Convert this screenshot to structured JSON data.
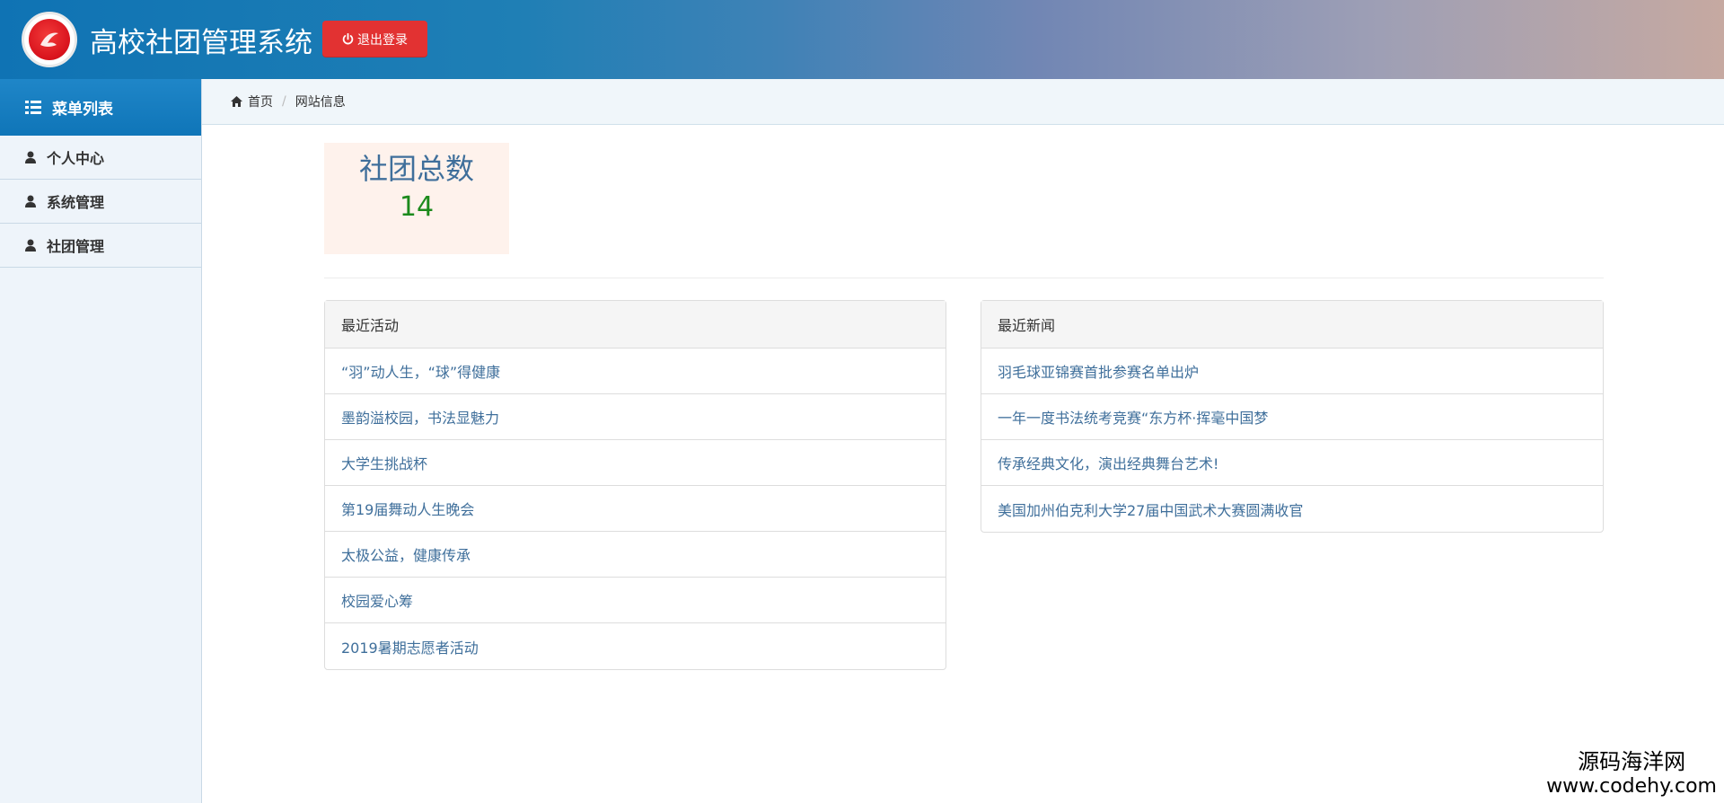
{
  "header": {
    "title": "高校社团管理系统",
    "logout_label": "退出登录",
    "logout_icon": "power-icon",
    "logo_icon": "university-logo"
  },
  "sidebar": {
    "menu_title": "菜单列表",
    "menu_icon": "list-icon",
    "items": [
      {
        "label": "个人中心",
        "icon": "user-icon"
      },
      {
        "label": "系统管理",
        "icon": "user-icon"
      },
      {
        "label": "社团管理",
        "icon": "user-icon"
      }
    ]
  },
  "breadcrumb": {
    "home": "首页",
    "current": "网站信息",
    "home_icon": "home-icon"
  },
  "stat": {
    "label": "社团总数",
    "value": "14"
  },
  "activities": {
    "title": "最近活动",
    "items": [
      "“羽”动人生，“球”得健康",
      "墨韵溢校园，书法显魅力",
      "大学生挑战杯",
      "第19届舞动人生晚会",
      "太极公益，健康传承",
      "校园爱心筹",
      "2019暑期志愿者活动"
    ]
  },
  "news": {
    "title": "最近新闻",
    "items": [
      "羽毛球亚锦赛首批参赛名单出炉",
      "一年一度书法统考竞赛“东方杯·挥毫中国梦",
      "传承经典文化，演出经典舞台艺术!",
      "美国加州伯克利大学27届中国武术大赛圆满收官"
    ]
  },
  "watermark": {
    "cn": "源码海洋网",
    "url": "www.codehy.com"
  },
  "colors": {
    "accent": "#1f86c8",
    "logout": "#e23232",
    "link": "#3f6f9b",
    "stat_value": "#1c8a1c"
  }
}
